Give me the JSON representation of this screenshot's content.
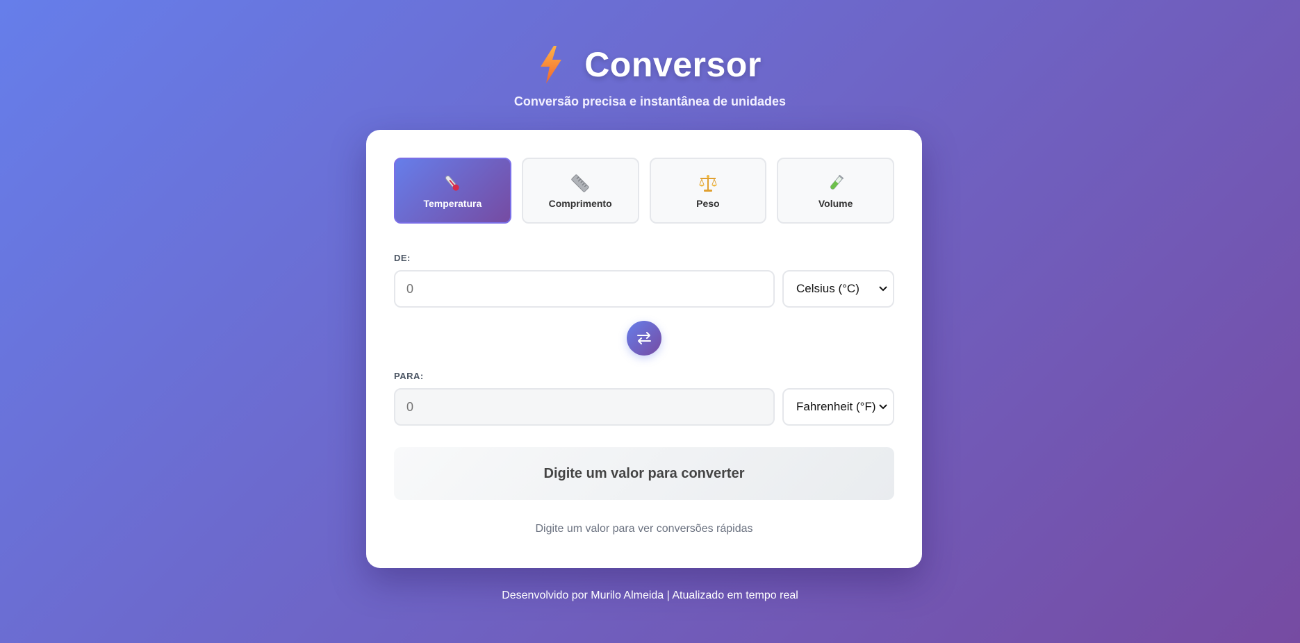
{
  "header": {
    "title": "Conversor",
    "subtitle": "Conversão precisa e instantânea de unidades",
    "icon": "lightning-bolt-icon"
  },
  "tabs": [
    {
      "label": "Temperatura",
      "icon": "thermometer-icon",
      "active": true
    },
    {
      "label": "Comprimento",
      "icon": "ruler-icon",
      "active": false
    },
    {
      "label": "Peso",
      "icon": "scales-icon",
      "active": false
    },
    {
      "label": "Volume",
      "icon": "test-tube-icon",
      "active": false
    }
  ],
  "from": {
    "label": "DE:",
    "placeholder": "0",
    "value": "",
    "unit": "Celsius (°C)"
  },
  "to": {
    "label": "PARA:",
    "placeholder": "0",
    "value": "",
    "unit": "Fahrenheit (°F)"
  },
  "swap": {
    "icon": "swap-arrows-icon"
  },
  "result": {
    "text": "Digite um valor para converter"
  },
  "quick": {
    "text": "Digite um valor para ver conversões rápidas"
  },
  "footer": {
    "text": "Desenvolvido por Murilo Almeida | Atualizado em tempo real"
  },
  "colors": {
    "gradient_start": "#667eea",
    "gradient_end": "#764ba2",
    "card_bg": "#ffffff"
  }
}
